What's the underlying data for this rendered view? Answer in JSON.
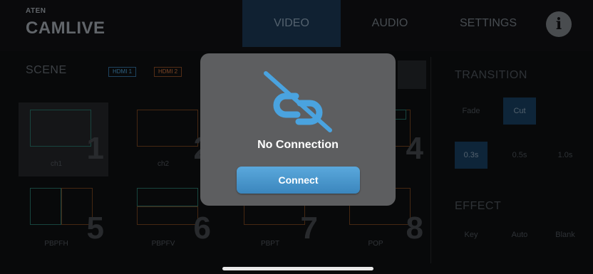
{
  "header": {
    "brand_small": "ATEN",
    "brand": "CAMLIVE",
    "tabs": [
      "VIDEO",
      "AUDIO",
      "SETTINGS"
    ],
    "info_icon": "info-icon"
  },
  "scene": {
    "title": "SCENE",
    "tags": [
      "HDMI 1",
      "HDMI 2"
    ],
    "cells": [
      {
        "number": "1",
        "label": "ch1"
      },
      {
        "number": "2",
        "label": "ch2"
      },
      {
        "number": "3",
        "label": ""
      },
      {
        "number": "4",
        "label": ""
      },
      {
        "number": "5",
        "label": "PBPFH"
      },
      {
        "number": "6",
        "label": "PBPFV"
      },
      {
        "number": "7",
        "label": "PBPT"
      },
      {
        "number": "8",
        "label": "POP"
      }
    ]
  },
  "transition": {
    "title": "TRANSITION",
    "modes": [
      "Fade",
      "Cut"
    ],
    "durations": [
      "0.3s",
      "0.5s",
      "1.0s"
    ]
  },
  "effect": {
    "title": "EFFECT",
    "buttons": [
      "Key",
      "Auto",
      "Blank"
    ]
  },
  "dialog": {
    "icon": "broken-link-icon",
    "title": "No Connection",
    "button": "Connect",
    "accent": "#4aa3df"
  }
}
